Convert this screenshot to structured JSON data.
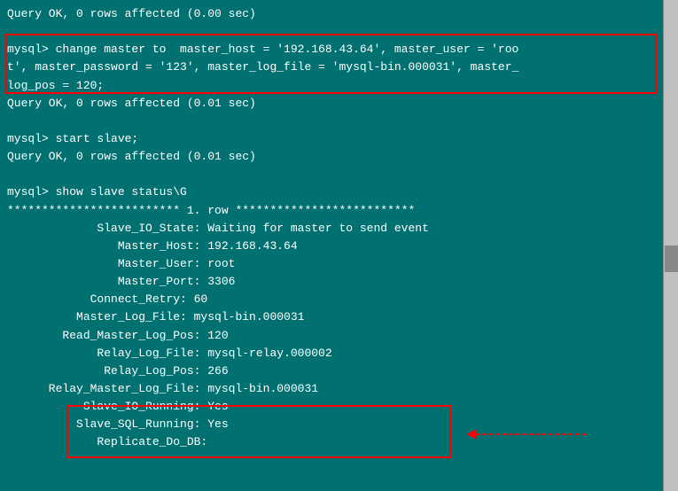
{
  "terminal": {
    "lines": [
      "Query OK, 0 rows affected (0.00 sec)",
      "",
      "mysql> change master to  master_host = '192.168.43.64', master_user = 'roo",
      "t', master_password = '123', master_log_file = 'mysql-bin.000031', master_",
      "log_pos = 120;",
      "Query OK, 0 rows affected (0.01 sec)",
      "",
      "mysql> start slave;",
      "Query OK, 0 rows affected (0.01 sec)",
      "",
      "mysql> show slave status\\G",
      "************************* 1. row **************************",
      "             Slave_IO_State: Waiting for master to send event",
      "                Master_Host: 192.168.43.64",
      "                Master_User: root",
      "                Master_Port: 3306",
      "            Connect_Retry: 60",
      "          Master_Log_File: mysql-bin.000031",
      "        Read_Master_Log_Pos: 120",
      "             Relay_Log_File: mysql-relay.000002",
      "              Relay_Log_Pos: 266",
      "      Relay_Master_Log_File: mysql-bin.000031",
      "           Slave_IO_Running: Yes",
      "          Slave_SQL_Running: Yes",
      "             Replicate_Do_DB:"
    ]
  }
}
